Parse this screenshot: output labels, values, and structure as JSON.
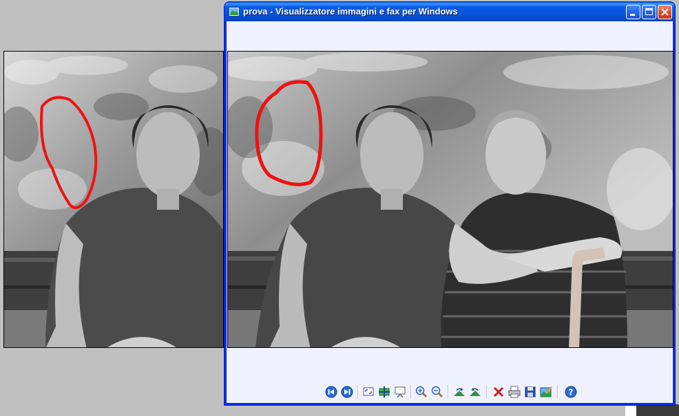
{
  "window": {
    "title": "prova - Visualizzatore immagini e fax per Windows",
    "controls": [
      "minimize",
      "maximize",
      "close"
    ]
  },
  "images": {
    "left": "black-and-white photo of a woman seated on a bench with a red freehand outline on the wall",
    "main": "black-and-white photo of two elderly women sitting on a bench, red freehand outline on the wall"
  },
  "toolbar": {
    "tools": [
      {
        "name": "previous-image-button",
        "icon": "prev-icon"
      },
      {
        "name": "next-image-button",
        "icon": "next-icon"
      },
      {
        "name": "best-fit-button",
        "icon": "best-fit-icon"
      },
      {
        "name": "actual-size-button",
        "icon": "actual-size-icon"
      },
      {
        "name": "slideshow-button",
        "icon": "slideshow-icon"
      },
      {
        "name": "zoom-in-button",
        "icon": "zoom-in-icon"
      },
      {
        "name": "zoom-out-button",
        "icon": "zoom-out-icon"
      },
      {
        "name": "rotate-clockwise-button",
        "icon": "rotate-cw-icon"
      },
      {
        "name": "rotate-counterclockwise-button",
        "icon": "rotate-ccw-icon"
      },
      {
        "name": "delete-button",
        "icon": "delete-icon"
      },
      {
        "name": "print-button",
        "icon": "print-icon"
      },
      {
        "name": "save-button",
        "icon": "save-icon"
      },
      {
        "name": "edit-button",
        "icon": "edit-icon"
      },
      {
        "name": "help-button",
        "icon": "help-icon"
      }
    ]
  },
  "colors": {
    "titlebar": "#0655dd",
    "client": "#eff2fe",
    "desktop": "#c0c0c0",
    "annotation": "#ee1111"
  }
}
